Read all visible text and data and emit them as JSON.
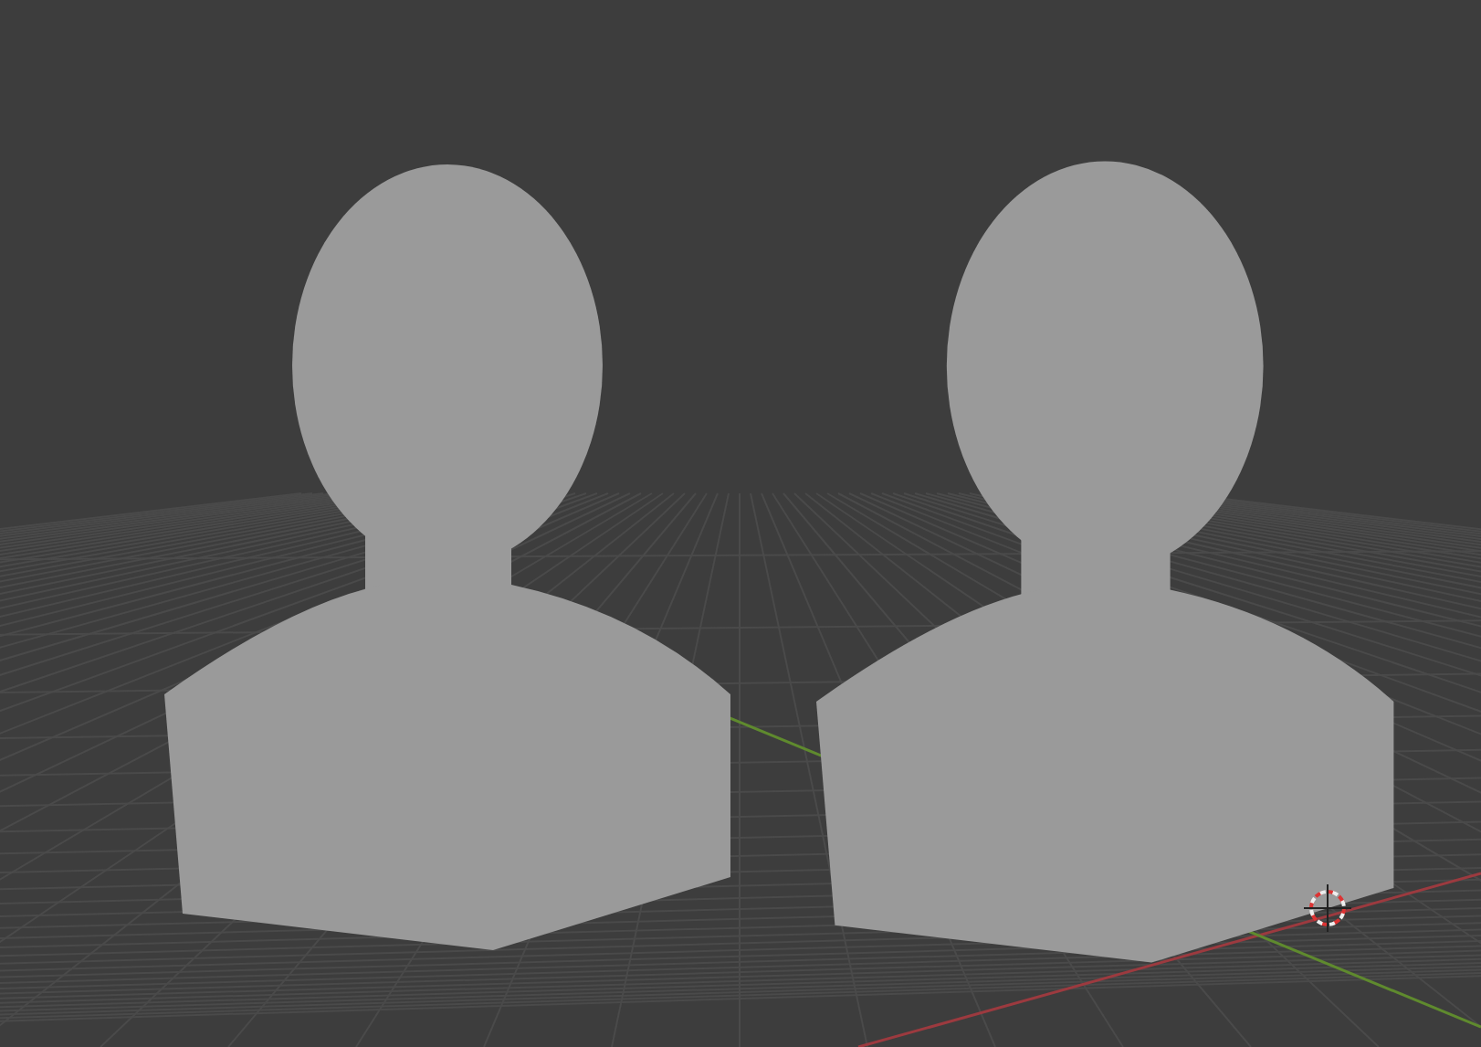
{
  "viewport": {
    "objects": [
      {
        "kind": "bust"
      },
      {
        "kind": "bust"
      }
    ],
    "axes": [
      {
        "kind": "x"
      },
      {
        "kind": "y"
      }
    ],
    "cursor": {
      "kind": "cursor"
    }
  }
}
